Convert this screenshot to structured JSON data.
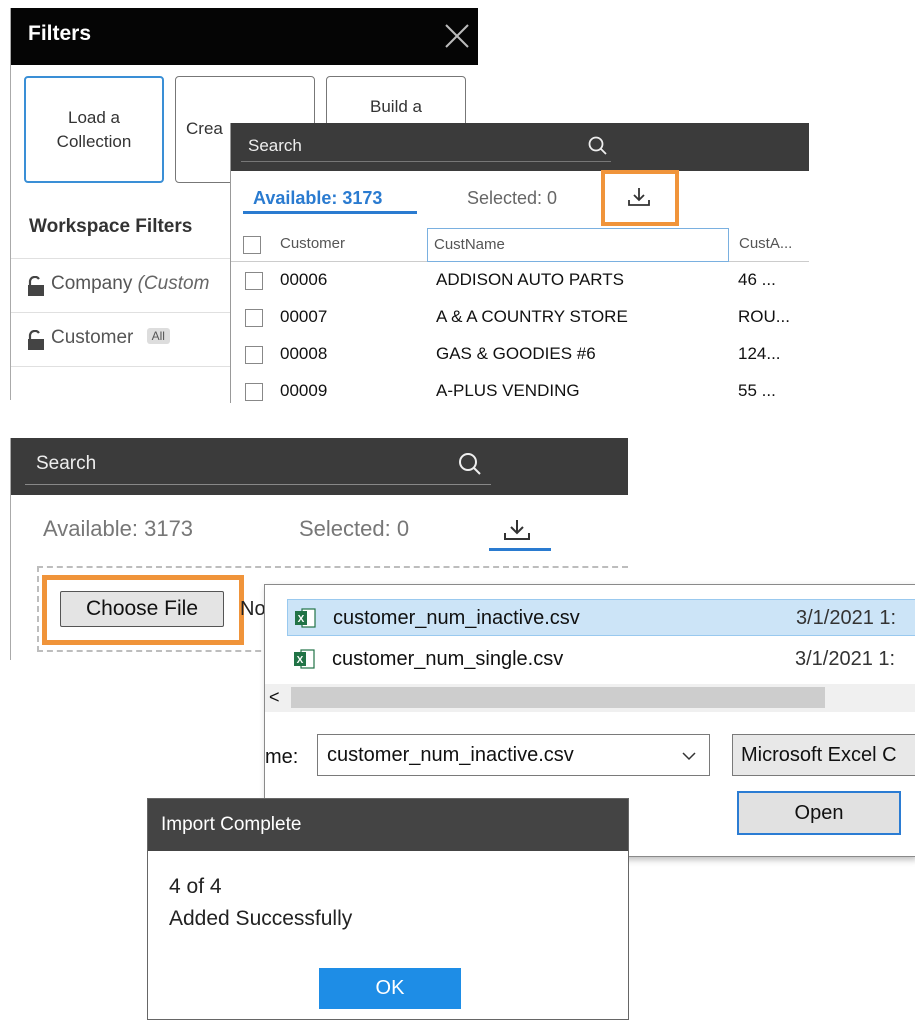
{
  "filters": {
    "title": "Filters",
    "tiles": {
      "load": "Load a\nCollection",
      "create": "Crea",
      "build": "Build a\nD"
    },
    "workspace_title": "Workspace Filters",
    "rows": [
      {
        "label": "Company",
        "suffix": "(Custom"
      },
      {
        "label": "Customer",
        "badge": "All"
      }
    ]
  },
  "list": {
    "search_placeholder": "Search",
    "tab_available": "Available: 3173",
    "tab_selected": "Selected: 0",
    "columns": [
      "Customer",
      "CustName",
      "CustA..."
    ],
    "rows": [
      {
        "id": "00006",
        "name": "ADDISON AUTO PARTS",
        "addr": "46 ..."
      },
      {
        "id": "00007",
        "name": "A & A COUNTRY STORE",
        "addr": "ROU..."
      },
      {
        "id": "00008",
        "name": "GAS & GOODIES #6",
        "addr": "124..."
      },
      {
        "id": "00009",
        "name": "A-PLUS VENDING",
        "addr": "55 ..."
      }
    ]
  },
  "panel2": {
    "search_placeholder": "Search",
    "tab_available": "Available: 3173",
    "tab_selected": "Selected: 0",
    "choose_file": "Choose File",
    "no_file": "No"
  },
  "file_dialog": {
    "files": [
      {
        "name": "customer_num_inactive.csv",
        "date": "3/1/2021 1:"
      },
      {
        "name": "customer_num_single.csv",
        "date": "3/1/2021 1:"
      }
    ],
    "filename_label": "me:",
    "filename_value": "customer_num_inactive.csv",
    "filetype_value": "Microsoft Excel C",
    "open_label": "Open",
    "scroll_left": "<"
  },
  "import_dialog": {
    "title": "Import Complete",
    "count": "4 of 4",
    "message": "Added Successfully",
    "ok_label": "OK"
  },
  "colors": {
    "accent_blue": "#2a7bd0",
    "highlight_orange": "#f0943a",
    "excel_green": "#217346"
  },
  "icons": [
    "close-icon",
    "lock-icon",
    "search-icon",
    "import-icon",
    "excel-file-icon",
    "chevron-down-icon"
  ]
}
